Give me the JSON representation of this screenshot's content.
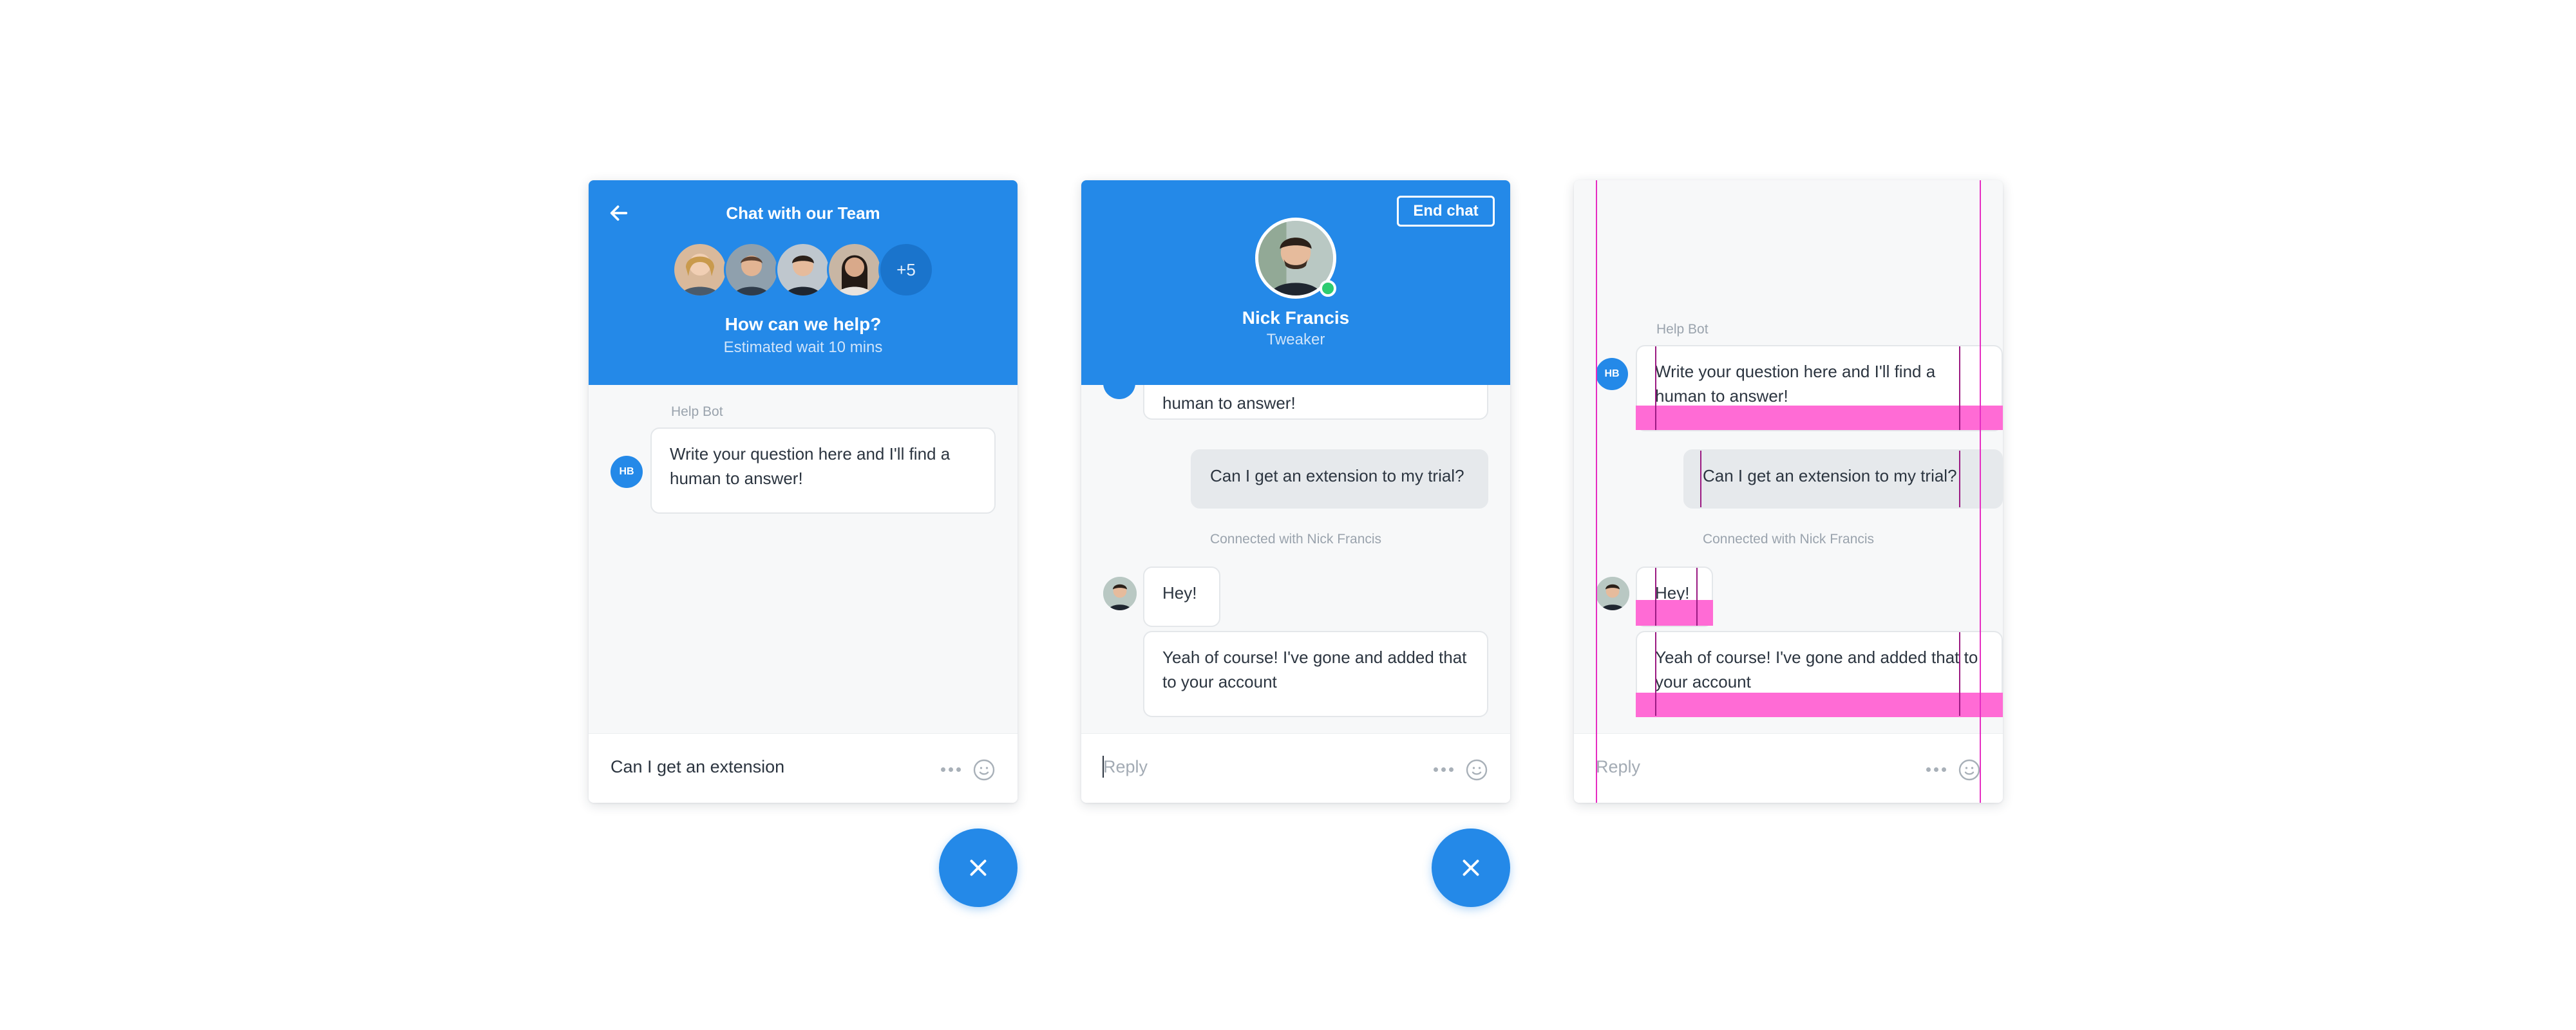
{
  "card1": {
    "header_title": "Chat with our Team",
    "more_count": "+5",
    "subtitle": "How can we help?",
    "wait_text": "Estimated wait 10 mins",
    "bot_label": "Help Bot",
    "bot_initials": "HB",
    "bot_message": "Write your question here and I'll find a human to answer!",
    "composer_value": "Can I get an extension"
  },
  "card2": {
    "end_chat_label": "End chat",
    "agent_name": "Nick Francis",
    "agent_role": "Tweaker",
    "bot_message_tail": "human to answer!",
    "user_message": "Can I get an extension to my trial?",
    "system_message": "Connected with Nick Francis",
    "agent_msg_1": "Hey!",
    "agent_msg_2": "Yeah of course! I've gone and added that to your account",
    "composer_placeholder": "Reply"
  },
  "card3": {
    "bot_label": "Help Bot",
    "bot_initials": "HB",
    "bot_message": "Write your question here and I'll find a human to answer!",
    "user_message": "Can I get an extension to my trial?",
    "system_message": "Connected with Nick Francis",
    "agent_msg_1": "Hey!",
    "agent_msg_2": "Yeah of course! I've gone and added that to your account",
    "composer_placeholder": "Reply"
  },
  "icons": {
    "back": "arrow-left-icon",
    "close": "close-icon",
    "more": "more-dots-icon",
    "emoji": "smiley-icon"
  },
  "colors": {
    "brand": "#2489e8",
    "online": "#2ecc71",
    "guide_overlay": "#ff6bd5"
  }
}
